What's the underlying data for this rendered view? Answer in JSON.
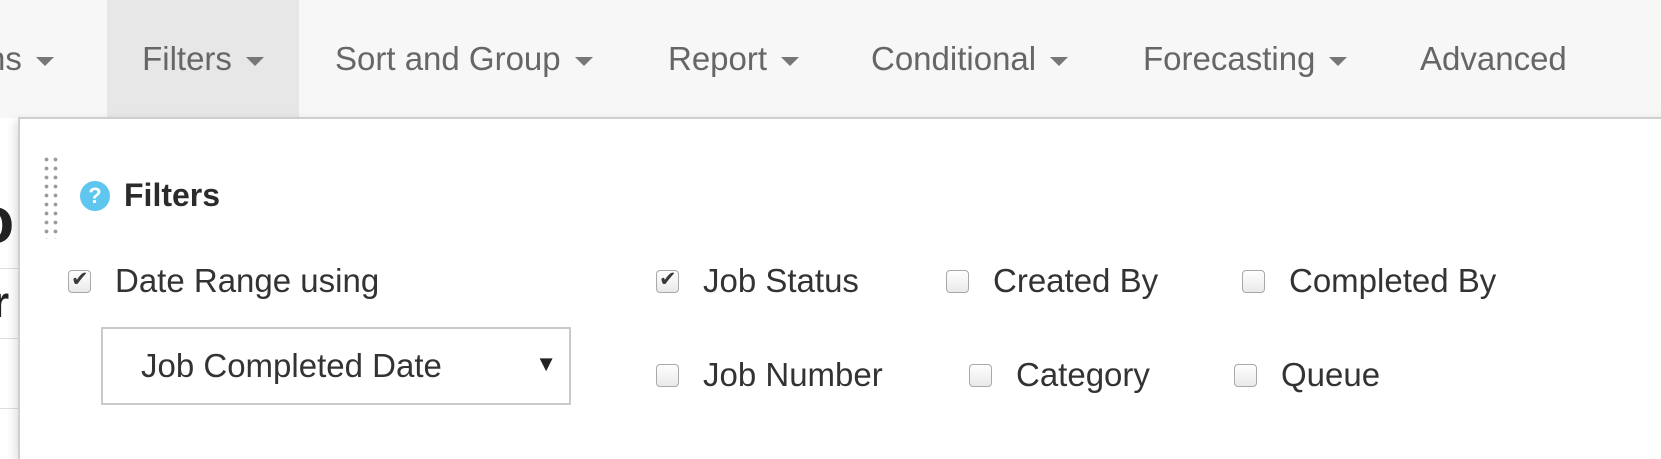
{
  "nav": {
    "items": [
      {
        "label": "ns"
      },
      {
        "label": "Filters"
      },
      {
        "label": "Sort and Group"
      },
      {
        "label": "Report"
      },
      {
        "label": "Conditional"
      },
      {
        "label": "Forecasting"
      },
      {
        "label": "Advanced"
      }
    ],
    "active": "Filters"
  },
  "background": {
    "fragment_1": "o",
    "fragment_2": "r"
  },
  "panel": {
    "title": "Filters",
    "help_glyph": "?",
    "date_range": {
      "label": "Date Range using",
      "checked": true
    },
    "date_field_select": {
      "value": "Job Completed Date",
      "arrow": "▼"
    },
    "filters": [
      {
        "label": "Job Status",
        "checked": true
      },
      {
        "label": "Created By",
        "checked": false
      },
      {
        "label": "Completed By",
        "checked": false
      },
      {
        "label": "Job Number",
        "checked": false
      },
      {
        "label": "Category",
        "checked": false
      },
      {
        "label": "Queue",
        "checked": false
      }
    ]
  },
  "colors": {
    "nav_bg": "#f7f7f7",
    "nav_active_bg": "#e7e7e7",
    "help_icon": "#5fc6f0"
  },
  "icons": {
    "caret": "caret-down-icon",
    "help": "question-circle-icon",
    "drag": "drag-handle-icon"
  }
}
